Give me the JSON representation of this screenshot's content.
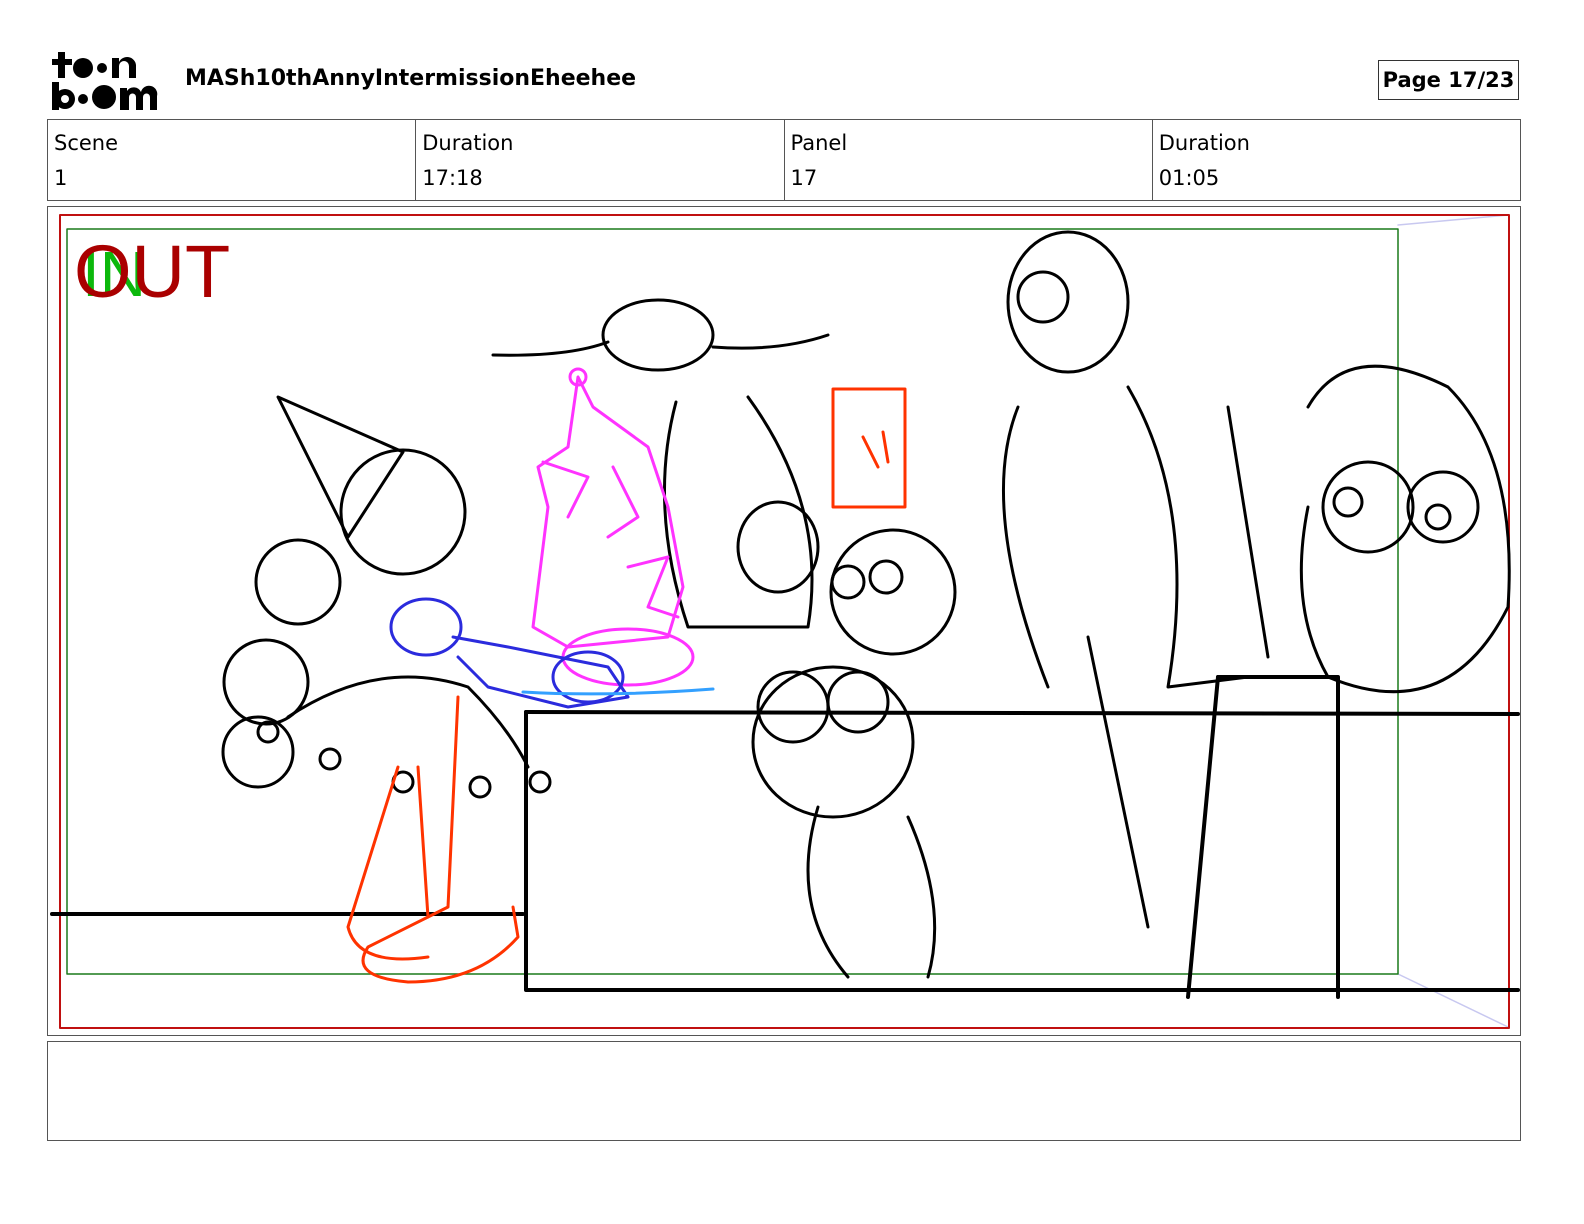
{
  "header": {
    "logo_text": "toon boom",
    "project_title": "MASh10thAnnyIntermissionEheehee",
    "page_label": "Page 17/23"
  },
  "info": [
    {
      "label": "Scene",
      "value": "1"
    },
    {
      "label": "Duration",
      "value": "17:18"
    },
    {
      "label": "Panel",
      "value": "17"
    },
    {
      "label": "Duration",
      "value": "01:05"
    }
  ],
  "panel": {
    "in_label": "IN",
    "out_label": "OUT",
    "colors": {
      "safe_frame": "#c01010",
      "camera_frame": "#1a7a1a",
      "in": "#0cb80c",
      "out": "#aa0000"
    }
  },
  "notes": {
    "text": ""
  }
}
